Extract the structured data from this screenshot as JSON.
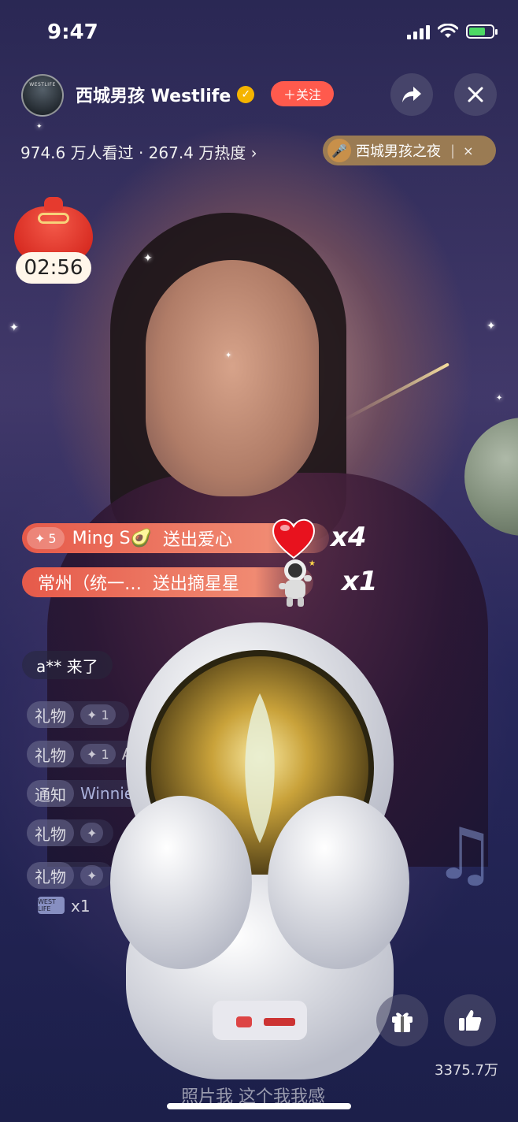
{
  "status_bar": {
    "time": "9:47",
    "battery_level": 0.7
  },
  "header": {
    "streamer_name": "西城男孩 Westlife",
    "avatar_text": "WESTLIFE",
    "verified_icon": "verified-check-icon",
    "follow_label": "＋关注",
    "share_icon": "share-arrow-icon",
    "close_icon": "close-icon",
    "stats_text": "974.6 万人看过 · 267.4 万热度 ›",
    "topic": {
      "icon": "microphone-icon",
      "label": "西城男孩之夜",
      "separator": "|",
      "close": "×"
    }
  },
  "red_packet": {
    "icon": "lucky-bag-icon",
    "countdown": "02:56"
  },
  "gift_banners": [
    {
      "level": "5",
      "sender": "Ming S🥑",
      "action": "送出爱心",
      "gift_icon": "heart-icon",
      "count": "x4"
    },
    {
      "level": "",
      "sender": "常州（统一…",
      "action": "送出摘星星",
      "gift_icon": "astronaut-icon",
      "count": "x1"
    }
  ],
  "join_message": "a** 来了",
  "chat": [
    {
      "tag": "礼物",
      "chip": "✦ 1",
      "extra": ""
    },
    {
      "tag": "礼物",
      "chip": "✦ 1",
      "extra": "A"
    },
    {
      "tag": "通知",
      "chip": "",
      "extra": "Winnie"
    },
    {
      "tag": "礼物",
      "chip": "✦",
      "extra": ""
    },
    {
      "tag": "礼物",
      "chip": "✦",
      "extra": ""
    }
  ],
  "chat_badge": {
    "text": "WEST LIFE",
    "count": "x1"
  },
  "actions": {
    "gift_icon": "gift-icon",
    "like_icon": "thumbs-up-icon",
    "music_icon": "music-note-icon",
    "like_count": "3375.7万"
  },
  "caption": "照片我 这个我我感"
}
